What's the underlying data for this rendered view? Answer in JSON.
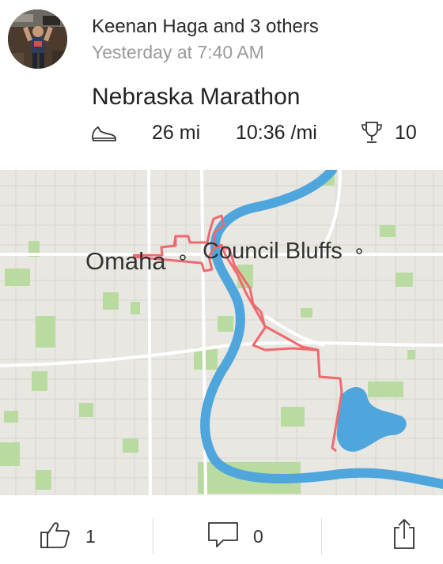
{
  "activity": {
    "athletes": "Keenan Haga and 3 others",
    "timestamp": "Yesterday at 7:40 AM",
    "title": "Nebraska Marathon",
    "stats": {
      "activity_type_icon": "shoe-icon",
      "distance": "26 mi",
      "pace": "10:36 /mi",
      "achievement_icon": "trophy-icon",
      "achievements": "10"
    }
  },
  "map": {
    "labels": {
      "city1": "Omaha",
      "city2": "Council Bluffs"
    },
    "colors": {
      "land": "#e9e7e2",
      "river": "#4fa6dc",
      "route": "#ef6a6e",
      "park": "#b9dba0",
      "road_major": "#ffffff"
    }
  },
  "actions": {
    "like_icon": "thumbs-up-icon",
    "kudos_count": "1",
    "comment_icon": "comment-icon",
    "comment_count": "0",
    "share_icon": "share-icon"
  }
}
